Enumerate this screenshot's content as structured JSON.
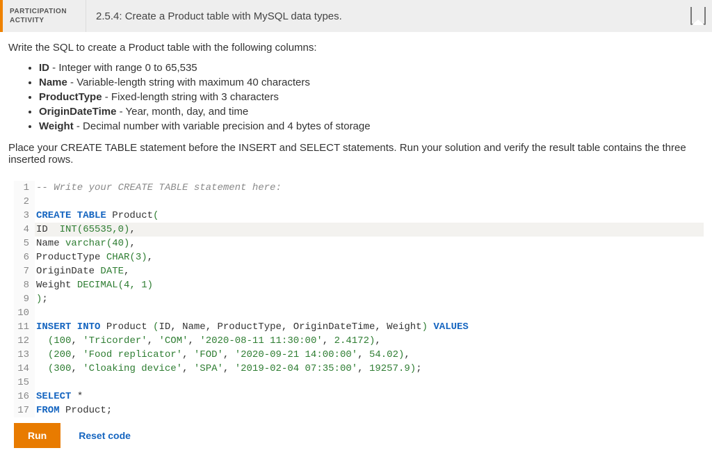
{
  "header": {
    "badge_line1": "PARTICIPATION",
    "badge_line2": "ACTIVITY",
    "title": "2.5.4: Create a Product table with MySQL data types."
  },
  "prompt": {
    "intro": "Write the SQL to create a Product table with the following columns:",
    "reqs": [
      {
        "b": "ID",
        "t": " - Integer with range 0 to 65,535"
      },
      {
        "b": "Name",
        "t": " - Variable-length string with maximum 40 characters"
      },
      {
        "b": "ProductType",
        "t": " - Fixed-length string with 3 characters"
      },
      {
        "b": "OriginDateTime",
        "t": " - Year, month, day, and time"
      },
      {
        "b": "Weight",
        "t": " - Decimal number with variable precision and 4 bytes of storage"
      }
    ],
    "trail": "Place your CREATE TABLE statement before the INSERT and SELECT statements. Run your solution and verify the result table contains the three inserted rows."
  },
  "editor": {
    "highlight_line": 4,
    "lines": [
      {
        "n": 1,
        "tok": [
          {
            "c": "comment",
            "t": "-- Write your CREATE TABLE statement here:"
          }
        ]
      },
      {
        "n": 2,
        "tok": []
      },
      {
        "n": 3,
        "tok": [
          {
            "c": "keyword",
            "t": "CREATE TABLE"
          },
          {
            "c": "ident",
            "t": " Product"
          },
          {
            "c": "type",
            "t": "("
          }
        ]
      },
      {
        "n": 4,
        "tok": [
          {
            "c": "ident",
            "t": "ID  "
          },
          {
            "c": "type",
            "t": "INT("
          },
          {
            "c": "number",
            "t": "65535"
          },
          {
            "c": "type",
            "t": ","
          },
          {
            "c": "number",
            "t": "0"
          },
          {
            "c": "type",
            "t": ")"
          },
          {
            "c": "punct",
            "t": ","
          }
        ]
      },
      {
        "n": 5,
        "tok": [
          {
            "c": "ident",
            "t": "Name "
          },
          {
            "c": "type",
            "t": "varchar("
          },
          {
            "c": "number",
            "t": "40"
          },
          {
            "c": "type",
            "t": ")"
          },
          {
            "c": "punct",
            "t": ","
          }
        ]
      },
      {
        "n": 6,
        "tok": [
          {
            "c": "ident",
            "t": "ProductType "
          },
          {
            "c": "type",
            "t": "CHAR("
          },
          {
            "c": "number",
            "t": "3"
          },
          {
            "c": "type",
            "t": ")"
          },
          {
            "c": "punct",
            "t": ","
          }
        ]
      },
      {
        "n": 7,
        "tok": [
          {
            "c": "ident",
            "t": "OriginDate "
          },
          {
            "c": "type",
            "t": "DATE"
          },
          {
            "c": "punct",
            "t": ","
          }
        ]
      },
      {
        "n": 8,
        "tok": [
          {
            "c": "ident",
            "t": "Weight "
          },
          {
            "c": "type",
            "t": "DECIMAL("
          },
          {
            "c": "number",
            "t": "4"
          },
          {
            "c": "type",
            "t": ", "
          },
          {
            "c": "number",
            "t": "1"
          },
          {
            "c": "type",
            "t": ")"
          }
        ]
      },
      {
        "n": 9,
        "tok": [
          {
            "c": "type",
            "t": ")"
          },
          {
            "c": "punct",
            "t": ";"
          }
        ]
      },
      {
        "n": 10,
        "tok": []
      },
      {
        "n": 11,
        "tok": [
          {
            "c": "insert",
            "t": "INSERT INTO"
          },
          {
            "c": "ident",
            "t": " Product "
          },
          {
            "c": "type",
            "t": "("
          },
          {
            "c": "ident",
            "t": "ID"
          },
          {
            "c": "punct",
            "t": ", "
          },
          {
            "c": "ident",
            "t": "Name"
          },
          {
            "c": "punct",
            "t": ", "
          },
          {
            "c": "ident",
            "t": "ProductType"
          },
          {
            "c": "punct",
            "t": ", "
          },
          {
            "c": "ident",
            "t": "OriginDateTime"
          },
          {
            "c": "punct",
            "t": ", "
          },
          {
            "c": "ident",
            "t": "Weight"
          },
          {
            "c": "type",
            "t": ")"
          },
          {
            "c": "keyword",
            "t": " VALUES"
          }
        ]
      },
      {
        "n": 12,
        "tok": [
          {
            "c": "ident",
            "t": "  "
          },
          {
            "c": "type",
            "t": "("
          },
          {
            "c": "number",
            "t": "100"
          },
          {
            "c": "punct",
            "t": ", "
          },
          {
            "c": "string",
            "t": "'Tricorder'"
          },
          {
            "c": "punct",
            "t": ", "
          },
          {
            "c": "string",
            "t": "'COM'"
          },
          {
            "c": "punct",
            "t": ", "
          },
          {
            "c": "string",
            "t": "'2020-08-11 11:30:00'"
          },
          {
            "c": "punct",
            "t": ", "
          },
          {
            "c": "number",
            "t": "2.4172"
          },
          {
            "c": "type",
            "t": ")"
          },
          {
            "c": "punct",
            "t": ","
          }
        ]
      },
      {
        "n": 13,
        "tok": [
          {
            "c": "ident",
            "t": "  "
          },
          {
            "c": "type",
            "t": "("
          },
          {
            "c": "number",
            "t": "200"
          },
          {
            "c": "punct",
            "t": ", "
          },
          {
            "c": "string",
            "t": "'Food replicator'"
          },
          {
            "c": "punct",
            "t": ", "
          },
          {
            "c": "string",
            "t": "'FOD'"
          },
          {
            "c": "punct",
            "t": ", "
          },
          {
            "c": "string",
            "t": "'2020-09-21 14:00:00'"
          },
          {
            "c": "punct",
            "t": ", "
          },
          {
            "c": "number",
            "t": "54.02"
          },
          {
            "c": "type",
            "t": ")"
          },
          {
            "c": "punct",
            "t": ","
          }
        ]
      },
      {
        "n": 14,
        "tok": [
          {
            "c": "ident",
            "t": "  "
          },
          {
            "c": "type",
            "t": "("
          },
          {
            "c": "number",
            "t": "300"
          },
          {
            "c": "punct",
            "t": ", "
          },
          {
            "c": "string",
            "t": "'Cloaking device'"
          },
          {
            "c": "punct",
            "t": ", "
          },
          {
            "c": "string",
            "t": "'SPA'"
          },
          {
            "c": "punct",
            "t": ", "
          },
          {
            "c": "string",
            "t": "'2019-02-04 07:35:00'"
          },
          {
            "c": "punct",
            "t": ", "
          },
          {
            "c": "number",
            "t": "19257.9"
          },
          {
            "c": "type",
            "t": ")"
          },
          {
            "c": "punct",
            "t": ";"
          }
        ]
      },
      {
        "n": 15,
        "tok": []
      },
      {
        "n": 16,
        "tok": [
          {
            "c": "keyword",
            "t": "SELECT"
          },
          {
            "c": "ident",
            "t": " *"
          }
        ]
      },
      {
        "n": 17,
        "tok": [
          {
            "c": "keyword",
            "t": "FROM"
          },
          {
            "c": "ident",
            "t": " Product"
          },
          {
            "c": "punct",
            "t": ";"
          }
        ]
      }
    ]
  },
  "buttons": {
    "run": "Run",
    "reset": "Reset code"
  }
}
